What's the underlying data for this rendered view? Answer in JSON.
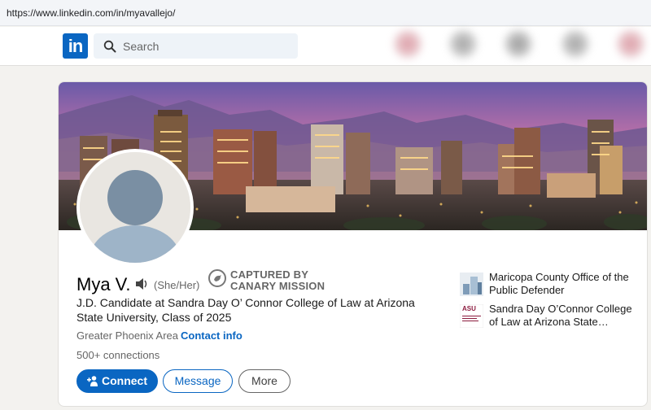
{
  "browser": {
    "url": "https://www.linkedin.com/in/myavallejo/"
  },
  "nav": {
    "logo_text": "in",
    "search_placeholder": "Search"
  },
  "profile": {
    "name": "Mya V.",
    "pronouns": "(She/Her)",
    "badge_line1": "CAPTURED BY",
    "badge_line2": "CANARY MISSION",
    "headline": "J.D. Candidate at Sandra Day O’ Connor College of Law at Arizona State University, Class of 2025",
    "location": "Greater Phoenix Area",
    "contact_label": "Contact info",
    "connections": "500+ connections"
  },
  "actions": {
    "connect": "Connect",
    "message": "Message",
    "more": "More"
  },
  "experience": [
    {
      "name": "Maricopa County Office of the Public Defender",
      "logo_text": ""
    },
    {
      "name": "Sandra Day O’Connor College of Law at Arizona State…",
      "logo_text": "ASU"
    }
  ],
  "colors": {
    "brand_blue": "#0a66c2",
    "page_bg": "#f3f2ef"
  }
}
